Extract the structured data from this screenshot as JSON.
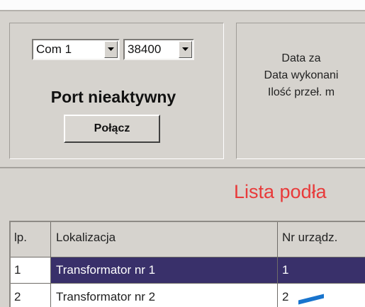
{
  "connection": {
    "port_value": "Com 1",
    "baud_value": "38400",
    "status_text": "Port nieaktywny",
    "connect_button": "Połącz"
  },
  "info": {
    "line1": "Data za",
    "line2": "Data wykonani",
    "line3": "Ilość przeł. m"
  },
  "list": {
    "title": "Lista podła",
    "columns": [
      "lp.",
      "Lokalizacja",
      "Nr urządz."
    ],
    "rows": [
      {
        "lp": "1",
        "lokalizacja": "Transformator nr 1",
        "nr": "1"
      },
      {
        "lp": "2",
        "lokalizacja": "Transformator nr 2",
        "nr": "2"
      }
    ]
  },
  "colors": {
    "window_bg": "#d6d3ce",
    "title_red": "#e83a3a",
    "selection": "#39306a"
  }
}
